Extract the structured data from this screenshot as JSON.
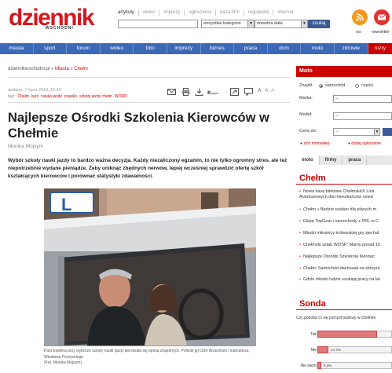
{
  "header": {
    "logo": "dziennik",
    "logo_sub": "WSCHODNI",
    "toplinks": [
      "artykuły",
      "wideo",
      "imprezy",
      "ogłoszenia",
      "baza firm",
      "regopedia",
      "internet"
    ],
    "category_select": "wszystkie kategorie",
    "date_select": "dowolna data",
    "search_button": "szukaj",
    "rss_label": "rss",
    "newsletter_label": "newsletter"
  },
  "nav": {
    "items": [
      "miasta",
      "sport",
      "forum",
      "wideo",
      "foto",
      "imprezy",
      "biznes",
      "praca",
      "dom",
      "moto",
      "zdrowie",
      "rozry"
    ],
    "active_index": 11
  },
  "article": {
    "breadcrumb_site": "dziennikwschodni.pl",
    "breadcrumb_sep1": " » ",
    "breadcrumb_section": "Miasta",
    "breadcrumb_sep2": " » ",
    "breadcrumb_city": "Chełm",
    "date": "dodano: 7 lipca 2010, 15:10",
    "tags_label": "tagi:",
    "tags": [
      "Chełm",
      "kurs",
      "nauka jazdy",
      "prawko",
      "szkoły jazdy chełm",
      "WORD"
    ],
    "title": "Najlepsze Ośrodki Szkolenia Kierowców w Chełmie",
    "author": "Monika Mojsym",
    "lead": "Wybór szkoły nauki jazdy to bardzo ważna decyzja. Każdy niezaliczony egzamin, to nie tylko ogromny stres, ale też niepotrzebnie wydane pieniądze. Żeby uniknąć zbędnych nerwów, lepiej wcześniej sprawdzić ofertę szkół kształcących kierowców i porównać statystyki zdawalności.",
    "photo_sign": "L",
    "caption": "Pani Ewelina przy wyborze szkoły nauki jazdy kierowała się opinią znajomych. Polecili jej OSK Brzeziński i instruktora, Wiesława Porzyckiego",
    "caption_credit": "(Fot. Monika Mojsym)",
    "tool_label_epapier": "e"
  },
  "moto": {
    "header": "Moto",
    "find_label": "Znajdź:",
    "radio_car": "samochód",
    "radio_parts": "części",
    "make_label": "Marka:",
    "model_label": "Model:",
    "price_label": "Cena do:",
    "dash": "--",
    "add_ad": "zlóż motoskłep",
    "add_category": "dodaj ogłoszenie",
    "tabs": [
      "moto",
      "firmy",
      "praca"
    ],
    "active_tab": 0
  },
  "chelm": {
    "title": "Chełm",
    "items": [
      "Nowa kasa biletowa Chełmskich Linii Autobusowych dla mieszkańców osied",
      "Chełm » Będzie szaban dla płacych m",
      "Ekipa TopGear i samochody z PRL w C",
      "Młodzi miłośnicy królewskiej gry zjechal",
      "Chełmski sztab WOŚP: Mamy ponad 10",
      "Najlepsze Ośrodki Szkolenia Kierowc",
      "Chełm: Samochód dachował na skrzyżo",
      "Gdzie młodzi ludzie szukają pracy na lat"
    ]
  },
  "sonda": {
    "title": "Sonda",
    "question": "Czy podoba Ci się pomysł budowy w Chełmie",
    "answers": [
      {
        "label": "Tak",
        "percent": 80.0,
        "pct_text": ""
      },
      {
        "label": "Nie",
        "percent": 14.7,
        "pct_text": "14,7%"
      },
      {
        "label": "Nie wiem",
        "percent": 5.3,
        "pct_text": "5,3%"
      }
    ]
  },
  "colors": {
    "brand_red": "#d3171f",
    "nav_blue": "#3b68b7",
    "accent_red": "#cc0000"
  }
}
